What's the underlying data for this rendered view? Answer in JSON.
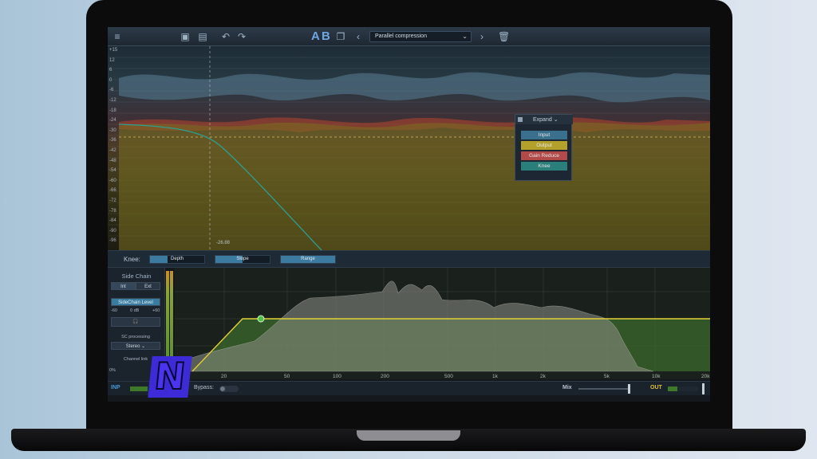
{
  "toolbar": {
    "ab_a": "A",
    "ab_b": "B",
    "preset": "Parallel compression",
    "icons": [
      "menu-icon",
      "save-icon",
      "save-as-icon",
      "undo-icon",
      "redo-icon",
      "copy-icon",
      "chevron-left-icon",
      "chevron-down-icon",
      "chevron-right-icon",
      "trash-icon"
    ]
  },
  "graph": {
    "y_labels": [
      "+15",
      "12",
      "6",
      "0",
      "-6",
      "-12",
      "-18",
      "-24",
      "-30",
      "-36",
      "-42",
      "-48",
      "-54",
      "-60",
      "-66",
      "-72",
      "-78",
      "-84",
      "-90",
      "-96"
    ],
    "threshold_label": "-26.88"
  },
  "popup": {
    "mode": "Expand",
    "items": [
      {
        "label": "Input",
        "color": "#3a6f8e"
      },
      {
        "label": "Output",
        "color": "#b3a12c"
      },
      {
        "label": "Gain Reduce",
        "color": "#b24a4a"
      },
      {
        "label": "Knee",
        "color": "#2a7f7a"
      }
    ]
  },
  "knee_bar": {
    "label": "Knee:",
    "sliders": [
      {
        "label": "Depth",
        "fill": 0.33
      },
      {
        "label": "Slope",
        "fill": 0.5
      },
      {
        "label": "Range",
        "fill": 1.0
      }
    ]
  },
  "sidechain": {
    "title": "Side Chain",
    "int": "Int",
    "ext": "Ext",
    "level_label": "SideChain Level",
    "range_min": "-60",
    "value": "0 dB",
    "range_max": "+60",
    "processing_label": "SC processing",
    "processing_value": "Stereo",
    "channel_label": "Channel link",
    "channel_value": "0%"
  },
  "spectrum": {
    "freq_labels": [
      "20",
      "50",
      "100",
      "200",
      "500",
      "1k",
      "2k",
      "5k",
      "10k",
      "20k"
    ]
  },
  "bottom": {
    "inp": "INP",
    "bypass": "Bypass:",
    "mix": "Mix",
    "out": "OUT"
  },
  "logo_letter": "N"
}
